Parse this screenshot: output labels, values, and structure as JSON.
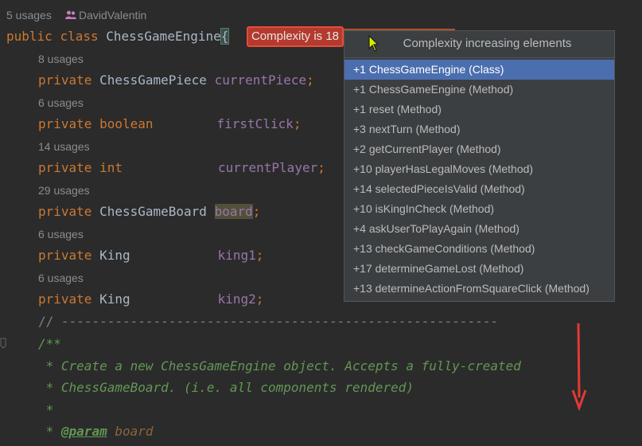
{
  "header_hint": {
    "usages": "5 usages",
    "author": "DavidValentin"
  },
  "class_decl": {
    "kw1": "public",
    "kw2": "class",
    "name": "ChessGameEngine",
    "brace": "{"
  },
  "badge": {
    "label": "Complexity is 18"
  },
  "fields": [
    {
      "usages": "8 usages",
      "mod": "private",
      "type": "ChessGamePiece",
      "name": "currentPiece",
      "semi": ";"
    },
    {
      "usages": "6 usages",
      "mod": "private",
      "type": "boolean",
      "name": "firstClick",
      "semi": ";"
    },
    {
      "usages": "14 usages",
      "mod": "private",
      "type": "int",
      "name": "currentPlayer",
      "semi": ";"
    },
    {
      "usages": "29 usages",
      "mod": "private",
      "type": "ChessGameBoard",
      "name": "board",
      "semi": ";"
    },
    {
      "usages": "6 usages",
      "mod": "private",
      "type": "King",
      "name": "king1",
      "semi": ";"
    },
    {
      "usages": "6 usages",
      "mod": "private",
      "type": "King",
      "name": "king2",
      "semi": ";"
    }
  ],
  "comment_rule": "// ---------------------------------------------------------",
  "javadoc": {
    "open": "/**",
    "line1": " * Create a new ChessGameEngine object. Accepts a fully-created",
    "line2": " * ChessGameBoard. (i.e. all components rendered)",
    "line3": " *",
    "line4_star": " * ",
    "line4_tag": "@param",
    "line4_param": "board"
  },
  "popup": {
    "title": "Complexity increasing elements",
    "items": [
      "+1 ChessGameEngine (Class)",
      "+1 ChessGameEngine (Method)",
      "+1 reset (Method)",
      "+3 nextTurn (Method)",
      "+2 getCurrentPlayer (Method)",
      "+10 playerHasLegalMoves (Method)",
      "+14 selectedPieceIsValid (Method)",
      "+10 isKingInCheck (Method)",
      "+4 askUserToPlayAgain (Method)",
      "+13 checkGameConditions (Method)",
      "+17 determineGameLost (Method)",
      "+13 determineActionFromSquareClick (Method)"
    ]
  },
  "colors": {
    "background": "#2b2b2b",
    "badge": "#b43a2d",
    "badge_border": "#e74c3c",
    "selection": "#4b6eaf",
    "annotation_arrow": "#e53935"
  },
  "icons": [
    "user-icon",
    "mouse-cursor-icon",
    "red-arrow-icon"
  ]
}
